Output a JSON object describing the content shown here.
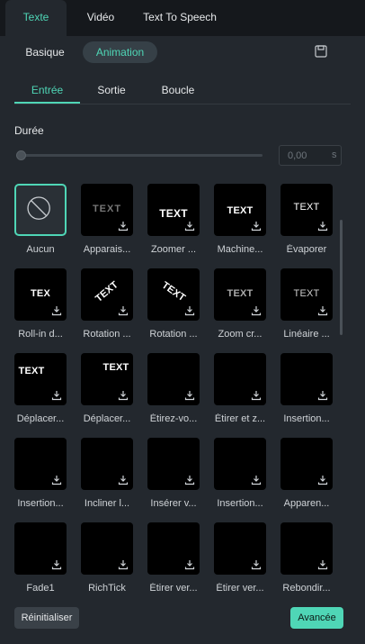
{
  "top_tabs": [
    {
      "label": "Texte"
    },
    {
      "label": "Vidéo"
    },
    {
      "label": "Text To Speech"
    }
  ],
  "segment": [
    {
      "label": "Basique"
    },
    {
      "label": "Animation"
    }
  ],
  "sub_tabs": [
    {
      "label": "Entrée"
    },
    {
      "label": "Sortie"
    },
    {
      "label": "Boucle"
    }
  ],
  "duration": {
    "label": "Durée",
    "value": "0,00",
    "unit": "s",
    "slider_fraction": 0
  },
  "presets": [
    {
      "label": "Aucun",
      "thumb_text": ""
    },
    {
      "label": "Apparais...",
      "thumb_text": "TEXT"
    },
    {
      "label": "Zoomer ...",
      "thumb_text": "TEXT"
    },
    {
      "label": "Machine...",
      "thumb_text": "TEXT"
    },
    {
      "label": "Évaporer",
      "thumb_text": "TEXT"
    },
    {
      "label": "Roll-in d...",
      "thumb_text": "TEX"
    },
    {
      "label": "Rotation ...",
      "thumb_text": "TEXT"
    },
    {
      "label": "Rotation ...",
      "thumb_text": "TEXT"
    },
    {
      "label": "Zoom cr...",
      "thumb_text": "TEXT"
    },
    {
      "label": "Linéaire ...",
      "thumb_text": "TEXT"
    },
    {
      "label": "Déplacer...",
      "thumb_text": "TEXT"
    },
    {
      "label": "Déplacer...",
      "thumb_text": "TEXT"
    },
    {
      "label": "Étirez-vo...",
      "thumb_text": ""
    },
    {
      "label": "Étirer et z...",
      "thumb_text": ""
    },
    {
      "label": "Insertion...",
      "thumb_text": ""
    },
    {
      "label": "Insertion...",
      "thumb_text": ""
    },
    {
      "label": "Incliner l...",
      "thumb_text": ""
    },
    {
      "label": "Insérer v...",
      "thumb_text": ""
    },
    {
      "label": "Insertion...",
      "thumb_text": ""
    },
    {
      "label": "Apparen...",
      "thumb_text": ""
    },
    {
      "label": "Fade1",
      "thumb_text": ""
    },
    {
      "label": "RichTick",
      "thumb_text": ""
    },
    {
      "label": "Étirer ver...",
      "thumb_text": ""
    },
    {
      "label": "Étirer ver...",
      "thumb_text": ""
    },
    {
      "label": "Rebondir...",
      "thumb_text": ""
    }
  ],
  "buttons": {
    "reset": "Réinitialiser",
    "advanced": "Avancée"
  },
  "icons": {
    "save": "save-icon",
    "none": "none-icon",
    "download": "download-icon"
  },
  "colors": {
    "accent": "#4fd6b6",
    "background": "#23282e",
    "tab_bar": "#15181c"
  }
}
